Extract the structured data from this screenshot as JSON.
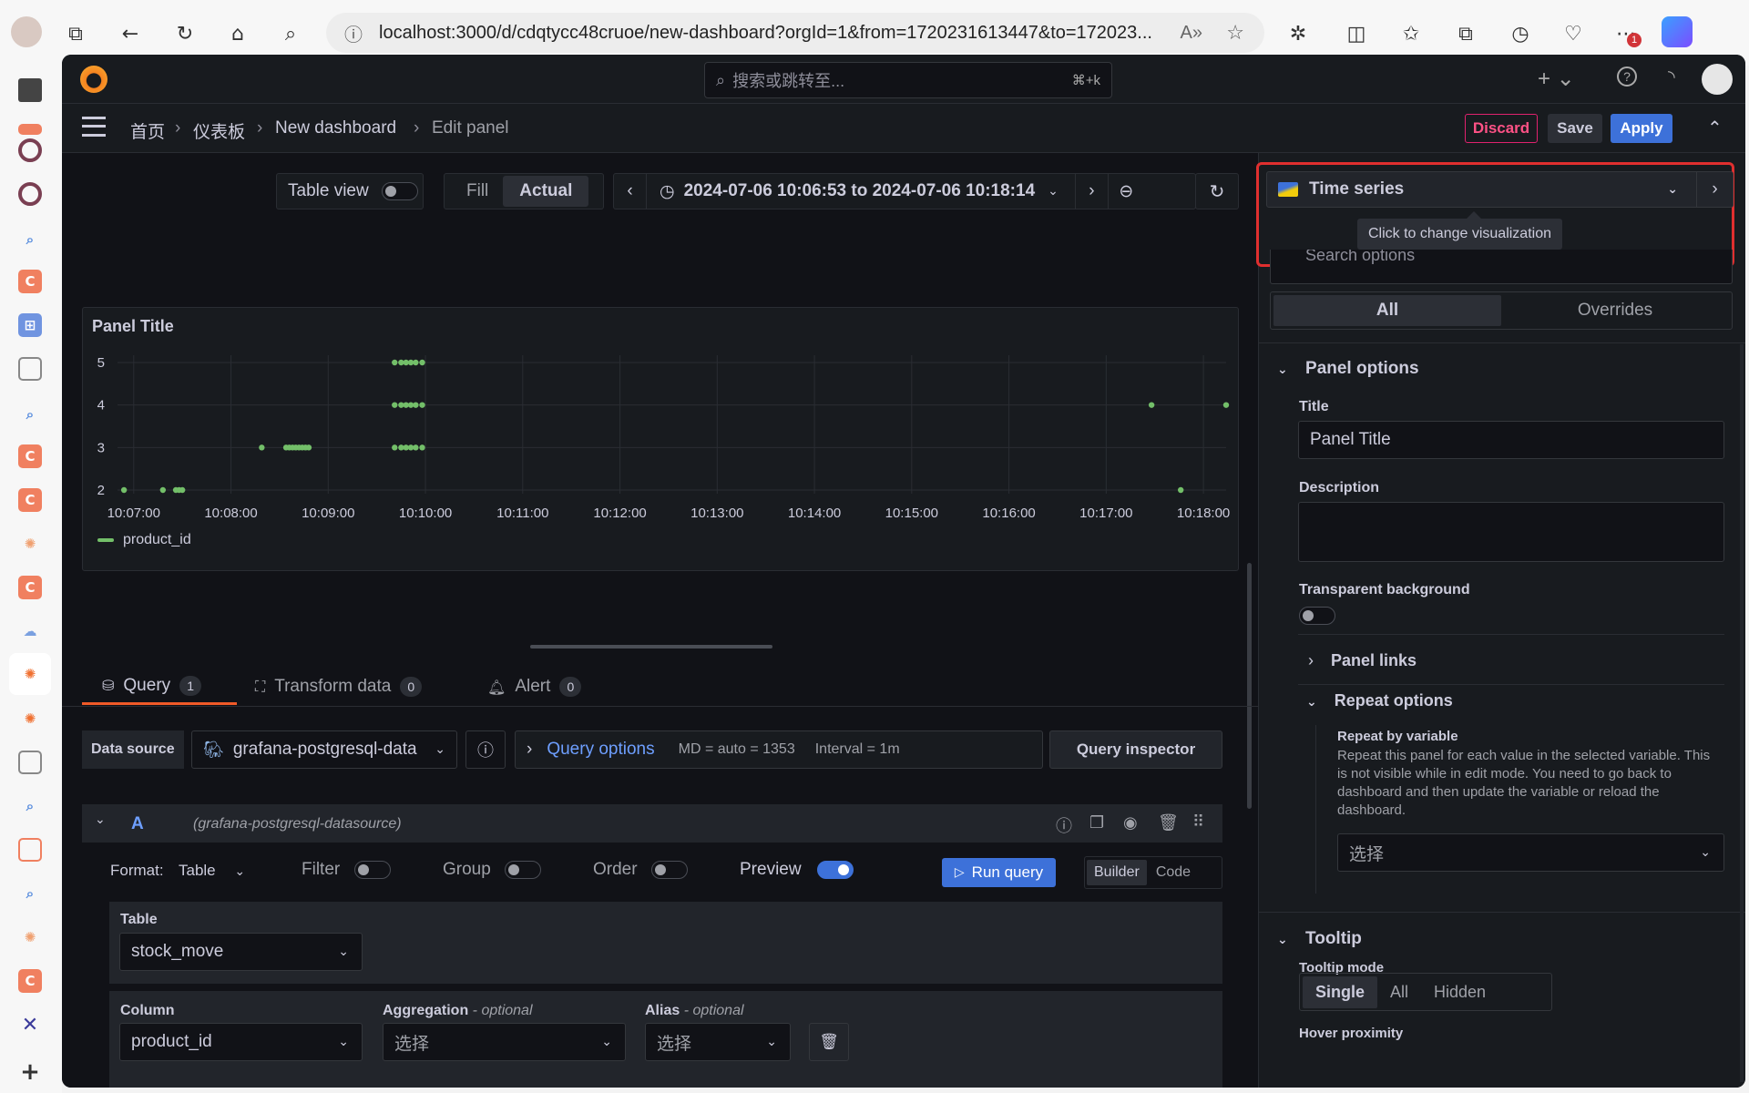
{
  "browser": {
    "url": "localhost:3000/d/cdqtycc48cruoe/new-dashboard?orgId=1&from=1720231613447&to=172023...",
    "notification_count": "1"
  },
  "topbar": {
    "search_placeholder": "搜索或跳转至...",
    "search_shortcut": "⌘+k"
  },
  "breadcrumb": {
    "home": "首页",
    "dashboards": "仪表板",
    "dashboard": "New dashboard",
    "current": "Edit panel"
  },
  "actions": {
    "discard": "Discard",
    "save": "Save",
    "apply": "Apply"
  },
  "panel_toolbar": {
    "table_view": "Table view",
    "fill": "Fill",
    "actual": "Actual",
    "time_range": "2024-07-06 10:06:53 to 2024-07-06 10:18:14"
  },
  "panel": {
    "title": "Panel Title"
  },
  "chart_data": {
    "type": "scatter",
    "title": "Panel Title",
    "y_ticks": [
      "5",
      "4",
      "3",
      "2"
    ],
    "x_ticks": [
      "10:07:00",
      "10:08:00",
      "10:09:00",
      "10:10:00",
      "10:11:00",
      "10:12:00",
      "10:13:00",
      "10:14:00",
      "10:15:00",
      "10:16:00",
      "10:17:00",
      "10:18:00"
    ],
    "ylim": [
      2,
      5
    ],
    "grid": true,
    "legend_placement": "bottom-left",
    "series": [
      {
        "name": "product_id",
        "color": "#73bf69",
        "points": [
          {
            "x": "10:06:54",
            "y": 2
          },
          {
            "x": "10:07:18",
            "y": 2
          },
          {
            "x": "10:07:26",
            "y": 2
          },
          {
            "x": "10:07:28",
            "y": 2
          },
          {
            "x": "10:07:30",
            "y": 2
          },
          {
            "x": "10:08:19",
            "y": 3
          },
          {
            "x": "10:08:34",
            "y": 3
          },
          {
            "x": "10:08:36",
            "y": 3
          },
          {
            "x": "10:08:38",
            "y": 3
          },
          {
            "x": "10:08:40",
            "y": 3
          },
          {
            "x": "10:08:42",
            "y": 3
          },
          {
            "x": "10:08:44",
            "y": 3
          },
          {
            "x": "10:08:46",
            "y": 3
          },
          {
            "x": "10:08:48",
            "y": 3
          },
          {
            "x": "10:09:41",
            "y": 3
          },
          {
            "x": "10:09:45",
            "y": 3
          },
          {
            "x": "10:09:48",
            "y": 3
          },
          {
            "x": "10:09:51",
            "y": 3
          },
          {
            "x": "10:09:54",
            "y": 3
          },
          {
            "x": "10:09:58",
            "y": 3
          },
          {
            "x": "10:09:41",
            "y": 4
          },
          {
            "x": "10:09:45",
            "y": 4
          },
          {
            "x": "10:09:48",
            "y": 4
          },
          {
            "x": "10:09:51",
            "y": 4
          },
          {
            "x": "10:09:54",
            "y": 4
          },
          {
            "x": "10:09:58",
            "y": 4
          },
          {
            "x": "10:09:41",
            "y": 5
          },
          {
            "x": "10:09:45",
            "y": 5
          },
          {
            "x": "10:09:48",
            "y": 5
          },
          {
            "x": "10:09:51",
            "y": 5
          },
          {
            "x": "10:09:54",
            "y": 5
          },
          {
            "x": "10:09:58",
            "y": 5
          },
          {
            "x": "10:17:28",
            "y": 4
          },
          {
            "x": "10:17:46",
            "y": 2
          },
          {
            "x": "10:18:14",
            "y": 4
          }
        ]
      }
    ]
  },
  "query_tabs": {
    "query": "Query",
    "query_count": "1",
    "transform": "Transform data",
    "transform_count": "0",
    "alert": "Alert",
    "alert_count": "0"
  },
  "datasource": {
    "label": "Data source",
    "value": "grafana-postgresql-data",
    "query_options": "Query options",
    "md": "MD = auto = 1353",
    "interval": "Interval = 1m",
    "inspector": "Query inspector"
  },
  "query_row": {
    "ref": "A",
    "datasource": "(grafana-postgresql-datasource)",
    "format_label": "Format:",
    "format_value": "Table",
    "filter": "Filter",
    "group": "Group",
    "order": "Order",
    "preview": "Preview",
    "run": "Run query",
    "builder": "Builder",
    "code": "Code"
  },
  "builder": {
    "table_label": "Table",
    "table_value": "stock_move",
    "column_label": "Column",
    "column_value": "product_id",
    "aggregation_label": "Aggregation",
    "alias_label": "Alias",
    "optional": "- optional",
    "agg_placeholder": "选择",
    "alias_placeholder": "选择"
  },
  "options": {
    "viz_name": "Time series",
    "viz_tooltip": "Click to change visualization",
    "search_placeholder": "Search options",
    "tab_all": "All",
    "tab_overrides": "Overrides",
    "panel_options": "Panel options",
    "title_label": "Title",
    "title_value": "Panel Title",
    "description_label": "Description",
    "transparent_label": "Transparent background",
    "panel_links": "Panel links",
    "repeat_options": "Repeat options",
    "repeat_by_label": "Repeat by variable",
    "repeat_help": "Repeat this panel for each value in the selected variable. This is not visible while in edit mode. You need to go back to dashboard and then update the variable or reload the dashboard.",
    "repeat_placeholder": "选择",
    "tooltip_section": "Tooltip",
    "tooltip_mode_label": "Tooltip mode",
    "mode_single": "Single",
    "mode_all": "All",
    "mode_hidden": "Hidden",
    "hover_label": "Hover proximity"
  },
  "colors": {
    "accent": "#3d71d9",
    "discard": "#e0226e",
    "highlight": "#e02f2f",
    "series": "#73bf69"
  }
}
